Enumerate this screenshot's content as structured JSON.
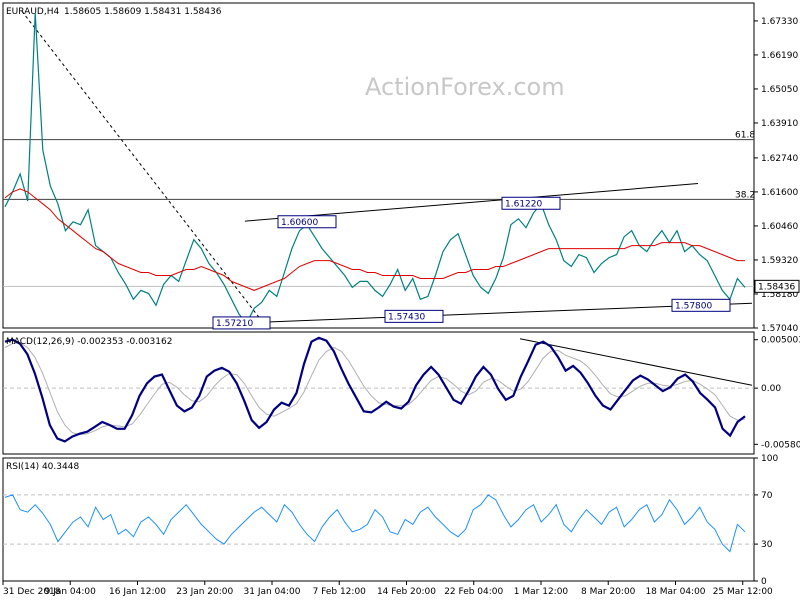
{
  "header": {
    "symbol": "EURAUD,H4",
    "ohlc": "1.58605 1.58609 1.58431 1.58436"
  },
  "watermark": "ActionForex.com",
  "colors": {
    "price": "#008080",
    "ma": "#e00000",
    "macd": "#000080",
    "signal": "#b0b0b0",
    "rsi": "#1e90ff",
    "trend": "#000000"
  },
  "chart_data": [
    {
      "type": "line",
      "panel": "price",
      "ylim": [
        1.5704,
        1.6793
      ],
      "y_ticks": [
        "1.67330",
        "1.66190",
        "1.65050",
        "1.63910",
        "1.62740",
        "1.61600",
        "1.60460",
        "1.59320",
        "1.58180",
        "1.57040"
      ],
      "current_price": "1.58436",
      "fib_levels": [
        {
          "label": "61.8",
          "value": 1.6335
        },
        {
          "label": "38.2",
          "value": 1.6135
        }
      ],
      "annotations": [
        {
          "label": "1.57210",
          "value": 1.5721
        },
        {
          "label": "1.60600",
          "value": 1.606
        },
        {
          "label": "1.57430",
          "value": 1.5743
        },
        {
          "label": "1.61220",
          "value": 1.6122
        },
        {
          "label": "1.57800",
          "value": 1.578
        }
      ],
      "series": [
        {
          "name": "price",
          "values": [
            1.611,
            1.616,
            1.622,
            1.613,
            1.676,
            1.63,
            1.618,
            1.612,
            1.603,
            1.606,
            1.605,
            1.61,
            1.598,
            1.596,
            1.594,
            1.589,
            1.585,
            1.58,
            1.583,
            1.582,
            1.578,
            1.585,
            1.588,
            1.586,
            1.593,
            1.6,
            1.597,
            1.592,
            1.589,
            1.585,
            1.58,
            1.575,
            1.572,
            1.577,
            1.579,
            1.583,
            1.581,
            1.589,
            1.597,
            1.603,
            1.605,
            1.601,
            1.597,
            1.594,
            1.591,
            1.588,
            1.584,
            1.586,
            1.586,
            1.583,
            1.581,
            1.585,
            1.59,
            1.583,
            1.587,
            1.58,
            1.581,
            1.588,
            1.596,
            1.6,
            1.602,
            1.595,
            1.588,
            1.584,
            1.582,
            1.587,
            1.594,
            1.605,
            1.607,
            1.604,
            1.609,
            1.612,
            1.605,
            1.6,
            1.593,
            1.591,
            1.595,
            1.594,
            1.589,
            1.592,
            1.594,
            1.595,
            1.601,
            1.603,
            1.598,
            1.596,
            1.6,
            1.603,
            1.599,
            1.603,
            1.596,
            1.598,
            1.595,
            1.593,
            1.588,
            1.583,
            1.58,
            1.587,
            1.584
          ]
        },
        {
          "name": "ma",
          "values": [
            1.614,
            1.616,
            1.617,
            1.616,
            1.614,
            1.612,
            1.61,
            1.607,
            1.605,
            1.603,
            1.601,
            1.599,
            1.597,
            1.596,
            1.594,
            1.592,
            1.591,
            1.59,
            1.589,
            1.589,
            1.588,
            1.588,
            1.588,
            1.589,
            1.59,
            1.59,
            1.591,
            1.59,
            1.589,
            1.588,
            1.586,
            1.585,
            1.584,
            1.583,
            1.584,
            1.585,
            1.586,
            1.587,
            1.589,
            1.591,
            1.592,
            1.593,
            1.593,
            1.593,
            1.592,
            1.591,
            1.59,
            1.59,
            1.589,
            1.589,
            1.588,
            1.588,
            1.588,
            1.588,
            1.588,
            1.587,
            1.587,
            1.587,
            1.587,
            1.588,
            1.589,
            1.589,
            1.59,
            1.59,
            1.59,
            1.591,
            1.591,
            1.592,
            1.593,
            1.594,
            1.595,
            1.596,
            1.597,
            1.597,
            1.597,
            1.597,
            1.597,
            1.597,
            1.597,
            1.597,
            1.597,
            1.597,
            1.597,
            1.598,
            1.598,
            1.598,
            1.598,
            1.599,
            1.599,
            1.599,
            1.599,
            1.598,
            1.598,
            1.597,
            1.596,
            1.595,
            1.594,
            1.593,
            1.593
          ]
        }
      ]
    },
    {
      "type": "line",
      "panel": "macd",
      "title": "MACD(12,26,9) -0.002353 -0.003162",
      "ylim": [
        -0.0068,
        0.0058
      ],
      "y_ticks": [
        "0.005003",
        "0.00",
        "-0.005801"
      ],
      "series": [
        {
          "name": "MACD",
          "values": [
            0.0048,
            0.005,
            0.0046,
            0.0035,
            0.0015,
            -0.001,
            -0.0038,
            -0.0052,
            -0.0055,
            -0.005,
            -0.0047,
            -0.0045,
            -0.004,
            -0.0035,
            -0.0038,
            -0.0042,
            -0.0042,
            -0.0028,
            -0.0008,
            0.0005,
            0.0012,
            0.0014,
            -0.0002,
            -0.0018,
            -0.0024,
            -0.002,
            -0.0008,
            0.0012,
            0.0018,
            0.0021,
            0.0017,
            0.0005,
            -0.0013,
            -0.0033,
            -0.0041,
            -0.0035,
            -0.0022,
            -0.0015,
            -0.0018,
            -0.0005,
            0.0025,
            0.0048,
            0.0052,
            0.0049,
            0.0038,
            0.002,
            0.0004,
            -0.001,
            -0.0024,
            -0.0025,
            -0.002,
            -0.0014,
            -0.0019,
            -0.0021,
            -0.0014,
            0.0003,
            0.0014,
            0.0022,
            0.0014,
            0.0001,
            -0.0012,
            -0.0016,
            -0.0003,
            0.0012,
            0.0022,
            0.0014,
            -0.0001,
            -0.0012,
            -0.0008,
            0.0012,
            0.0028,
            0.0045,
            0.0048,
            0.0043,
            0.0032,
            0.0018,
            0.0023,
            0.0016,
            0.0005,
            -0.0008,
            -0.0018,
            -0.0022,
            -0.0012,
            -0.0002,
            0.0008,
            0.0013,
            0.0009,
            0.0003,
            -0.0003,
            0.0001,
            0.001,
            0.0014,
            0.0007,
            -0.0005,
            -0.0012,
            -0.002,
            -0.0042,
            -0.0049,
            -0.0035,
            -0.0029
          ]
        },
        {
          "name": "Signal",
          "values": [
            0.0042,
            0.0046,
            0.0047,
            0.0042,
            0.0032,
            0.0016,
            -0.0004,
            -0.0024,
            -0.0038,
            -0.0046,
            -0.0048,
            -0.0047,
            -0.0044,
            -0.004,
            -0.0038,
            -0.0039,
            -0.004,
            -0.0037,
            -0.0028,
            -0.0017,
            -0.0006,
            0.0004,
            0.0006,
            0.0001,
            -0.0007,
            -0.0013,
            -0.0014,
            -0.0008,
            0.0002,
            0.001,
            0.0015,
            0.0014,
            0.0005,
            -0.0008,
            -0.002,
            -0.0027,
            -0.0029,
            -0.0025,
            -0.0021,
            -0.0016,
            -0.0004,
            0.0013,
            0.0029,
            0.0038,
            0.0042,
            0.0038,
            0.0028,
            0.0015,
            0.0002,
            -0.0008,
            -0.0015,
            -0.0017,
            -0.0018,
            -0.0018,
            -0.0017,
            -0.001,
            -0.0001,
            0.0008,
            0.0012,
            0.001,
            0.0004,
            -0.0003,
            -0.0007,
            -0.0003,
            0.0006,
            0.001,
            0.0008,
            0.0002,
            -0.0003,
            -0.0001,
            0.0007,
            0.0019,
            0.0031,
            0.0038,
            0.0039,
            0.0034,
            0.0031,
            0.0028,
            0.0022,
            0.0013,
            0.0003,
            -0.0006,
            -0.0009,
            -0.0008,
            -0.0003,
            0.0002,
            0.0005,
            0.0005,
            0.0003,
            0.0002,
            0.0004,
            0.0007,
            0.0008,
            0.0004,
            -0.0001,
            -0.0007,
            -0.0018,
            -0.0029,
            -0.0033,
            -0.0032
          ]
        }
      ]
    },
    {
      "type": "line",
      "panel": "rsi",
      "title": "RSI(14) 40.3448",
      "ylim": [
        0,
        100
      ],
      "y_ticks": [
        "100",
        "70",
        "30",
        "0"
      ],
      "series": [
        {
          "name": "RSI",
          "values": [
            68,
            70,
            58,
            56,
            62,
            55,
            46,
            32,
            40,
            48,
            52,
            44,
            60,
            50,
            54,
            38,
            42,
            36,
            48,
            52,
            46,
            38,
            50,
            56,
            62,
            54,
            46,
            40,
            34,
            30,
            38,
            44,
            50,
            56,
            60,
            54,
            48,
            62,
            56,
            46,
            38,
            32,
            44,
            52,
            58,
            48,
            40,
            42,
            46,
            58,
            52,
            40,
            38,
            50,
            46,
            56,
            60,
            52,
            46,
            40,
            36,
            42,
            58,
            62,
            70,
            66,
            54,
            44,
            50,
            58,
            62,
            48,
            54,
            62,
            46,
            40,
            50,
            58,
            52,
            46,
            56,
            60,
            44,
            50,
            58,
            62,
            48,
            54,
            66,
            58,
            46,
            52,
            60,
            48,
            42,
            30,
            24,
            46,
            40
          ]
        }
      ]
    }
  ],
  "x_axis": {
    "labels": [
      "31 Dec 2018",
      "9 Jan 04:00",
      "16 Jan 12:00",
      "23 Jan 20:00",
      "31 Jan 04:00",
      "7 Feb 12:00",
      "14 Feb 20:00",
      "22 Feb 04:00",
      "1 Mar 12:00",
      "8 Mar 20:00",
      "18 Mar 04:00",
      "25 Mar 12:00"
    ]
  }
}
